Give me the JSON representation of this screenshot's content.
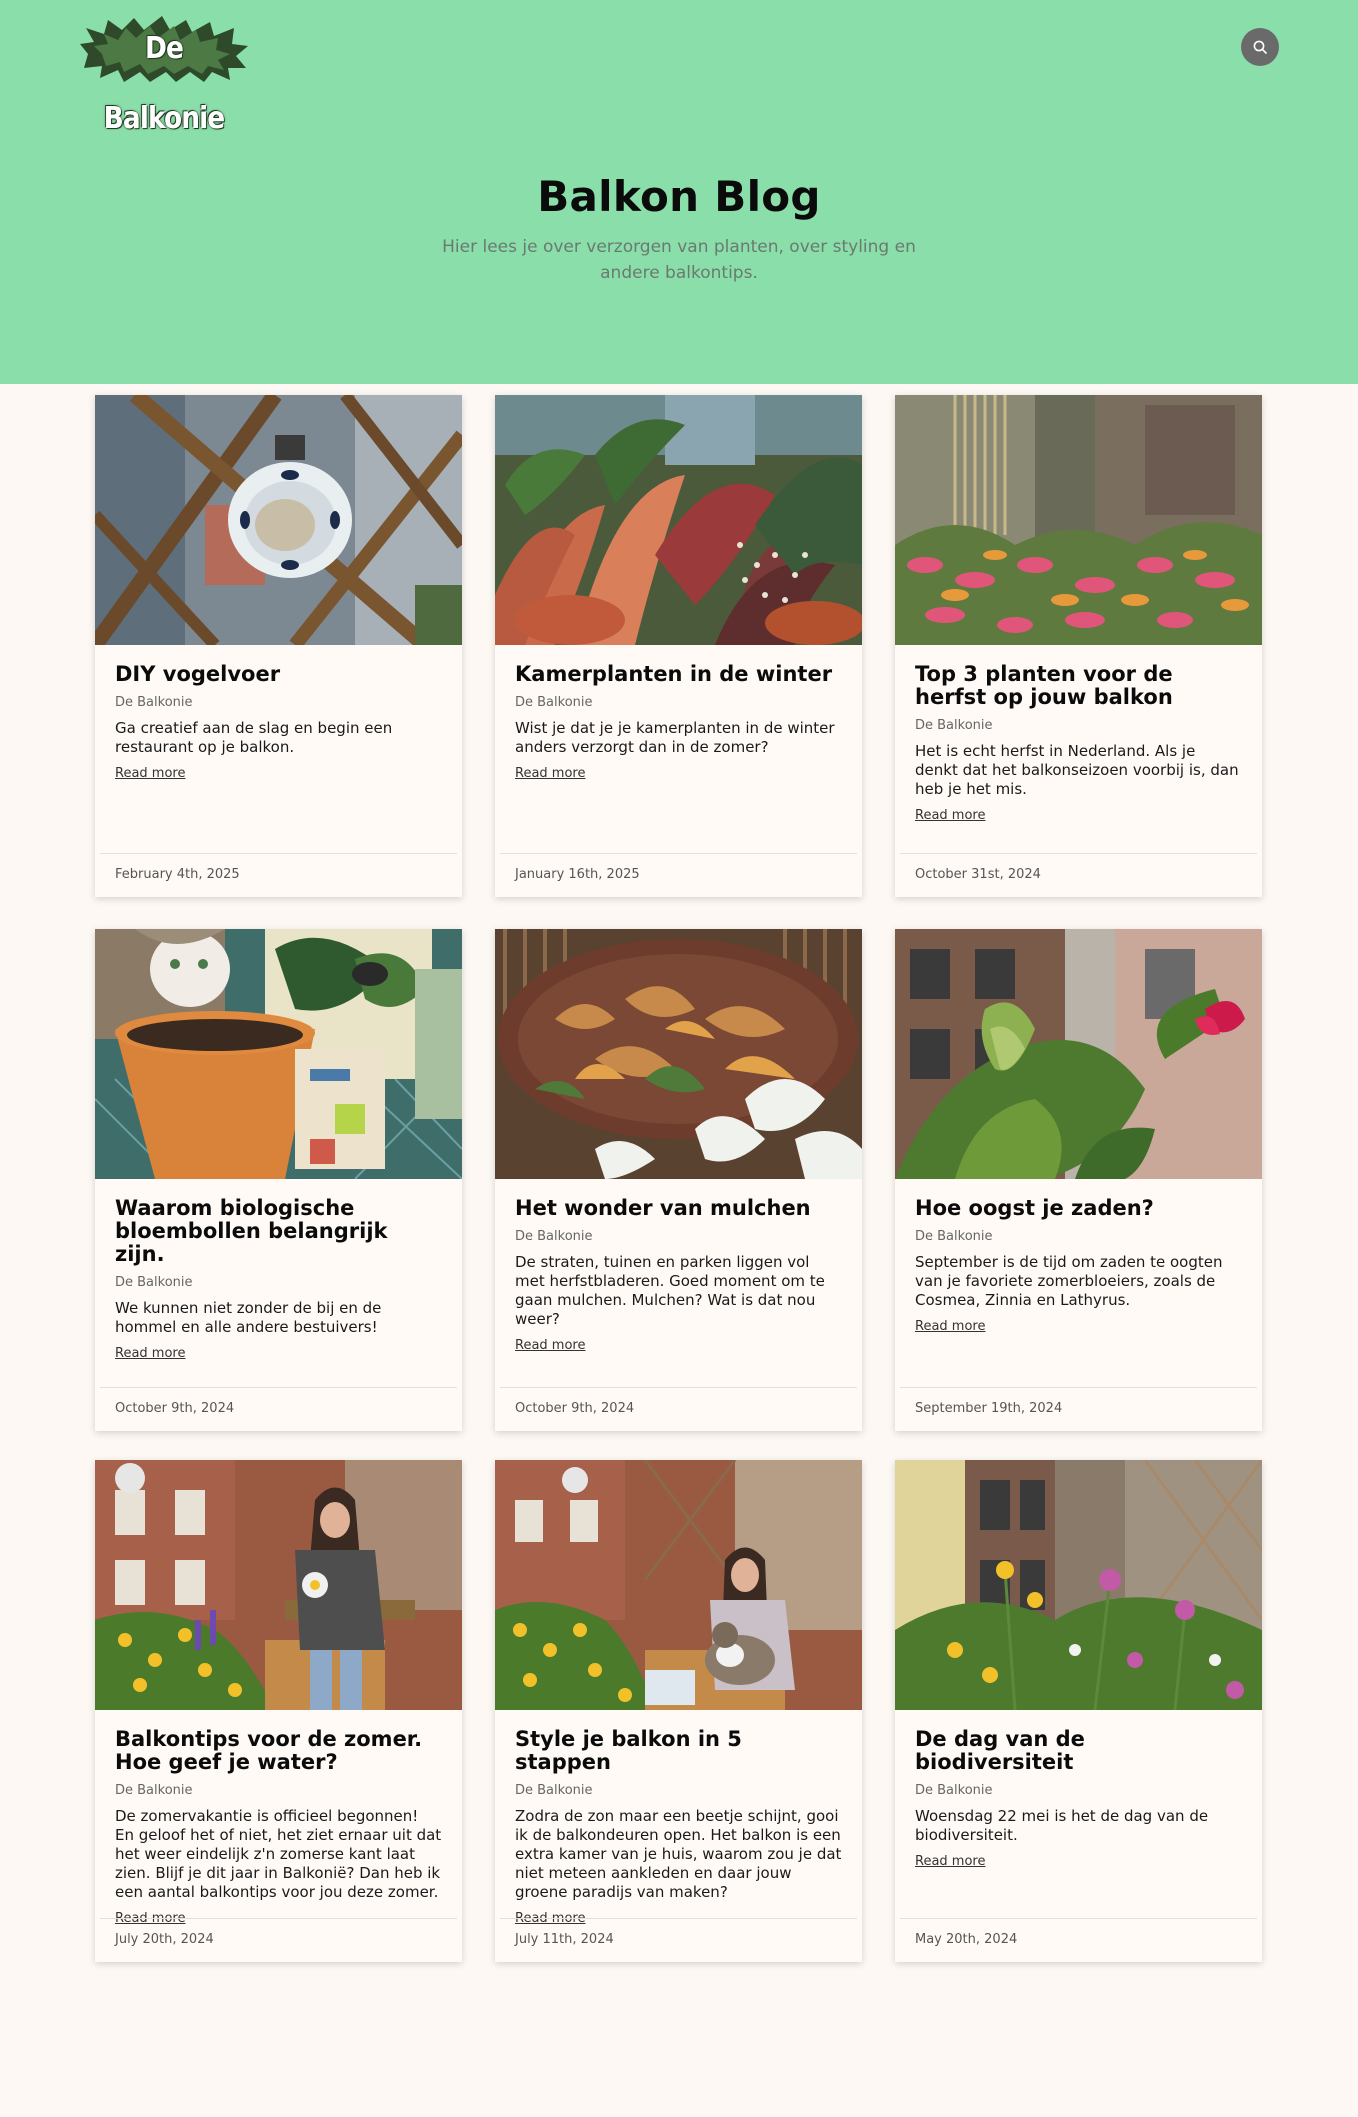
{
  "header": {
    "logo_text": "De Balkonie",
    "search_icon": "search-icon",
    "background_color": "#8adeaa"
  },
  "hero": {
    "title": "Balkon Blog",
    "subtitle": "Hier lees je over verzorgen van planten, over styling en andere balkontips."
  },
  "read_more_label": "Read more",
  "posts": [
    {
      "title": "DIY vogelvoer",
      "author": "De Balkonie",
      "excerpt": "Ga creatief aan de slag en begin een restaurant op je balkon.",
      "date": "February 4th, 2025",
      "image": "bird-feeder-photo"
    },
    {
      "title": "Kamerplanten in de winter",
      "author": "De Balkonie",
      "excerpt": "Wist je dat je je kamerplanten in de winter anders verzorgt dan in de zomer?",
      "date": "January 16th, 2025",
      "image": "houseplants-photo"
    },
    {
      "title": "Top 3 planten voor de herfst op jouw balkon",
      "author": "De Balkonie",
      "excerpt": "Het is echt herfst in Nederland. Als je denkt dat het balkonseizoen voorbij is, dan heb je het mis.",
      "date": "October 31st, 2024",
      "image": "autumn-plants-photo"
    },
    {
      "title": "Waarom biologische bloembollen belangrijk zijn.",
      "author": "De Balkonie",
      "excerpt": "We kunnen niet zonder de bij en de hommel en alle andere bestuivers!",
      "date": "October 9th, 2024",
      "image": "flower-bulbs-photo"
    },
    {
      "title": "Het wonder van mulchen",
      "author": "De Balkonie",
      "excerpt": "De straten, tuinen en parken liggen vol met herfstbladeren. Goed moment om te gaan mulchen. Mulchen? Wat is dat nou weer?",
      "date": "October 9th, 2024",
      "image": "mulch-leaves-photo"
    },
    {
      "title": "Hoe oogst je zaden?",
      "author": "De Balkonie",
      "excerpt": "September is de tijd om zaden te oogten van je favoriete zomerbloeiers, zoals de Cosmea, Zinnia en Lathyrus.",
      "date": "September 19th, 2024",
      "image": "seed-pod-photo"
    },
    {
      "title": "Balkontips voor de zomer. Hoe geef je water?",
      "author": "De Balkonie",
      "excerpt": "De zomervakantie is officieel begonnen! En geloof het of niet, het ziet ernaar uit dat het weer eindelijk z'n zomerse kant laat zien. Blijf je dit jaar in Balkonië? Dan heb ik een aantal balkontips voor jou deze zomer.",
      "date": "July 20th, 2024",
      "image": "watering-balcony-photo"
    },
    {
      "title": "Style je balkon in 5 stappen",
      "author": "De Balkonie",
      "excerpt": "Zodra de zon maar een beetje schijnt, gooi ik de balkondeuren open. Het balkon is een extra kamer van je huis, waarom zou je dat niet meteen aankleden en daar jouw groene paradijs van maken?",
      "date": "July 11th, 2024",
      "image": "balcony-with-cat-photo"
    },
    {
      "title": "De dag van de biodiversiteit",
      "author": "De Balkonie",
      "excerpt": "Woensdag 22 mei is het de dag van de biodiversiteit.",
      "date": "May 20th, 2024",
      "image": "wildflowers-photo"
    }
  ]
}
